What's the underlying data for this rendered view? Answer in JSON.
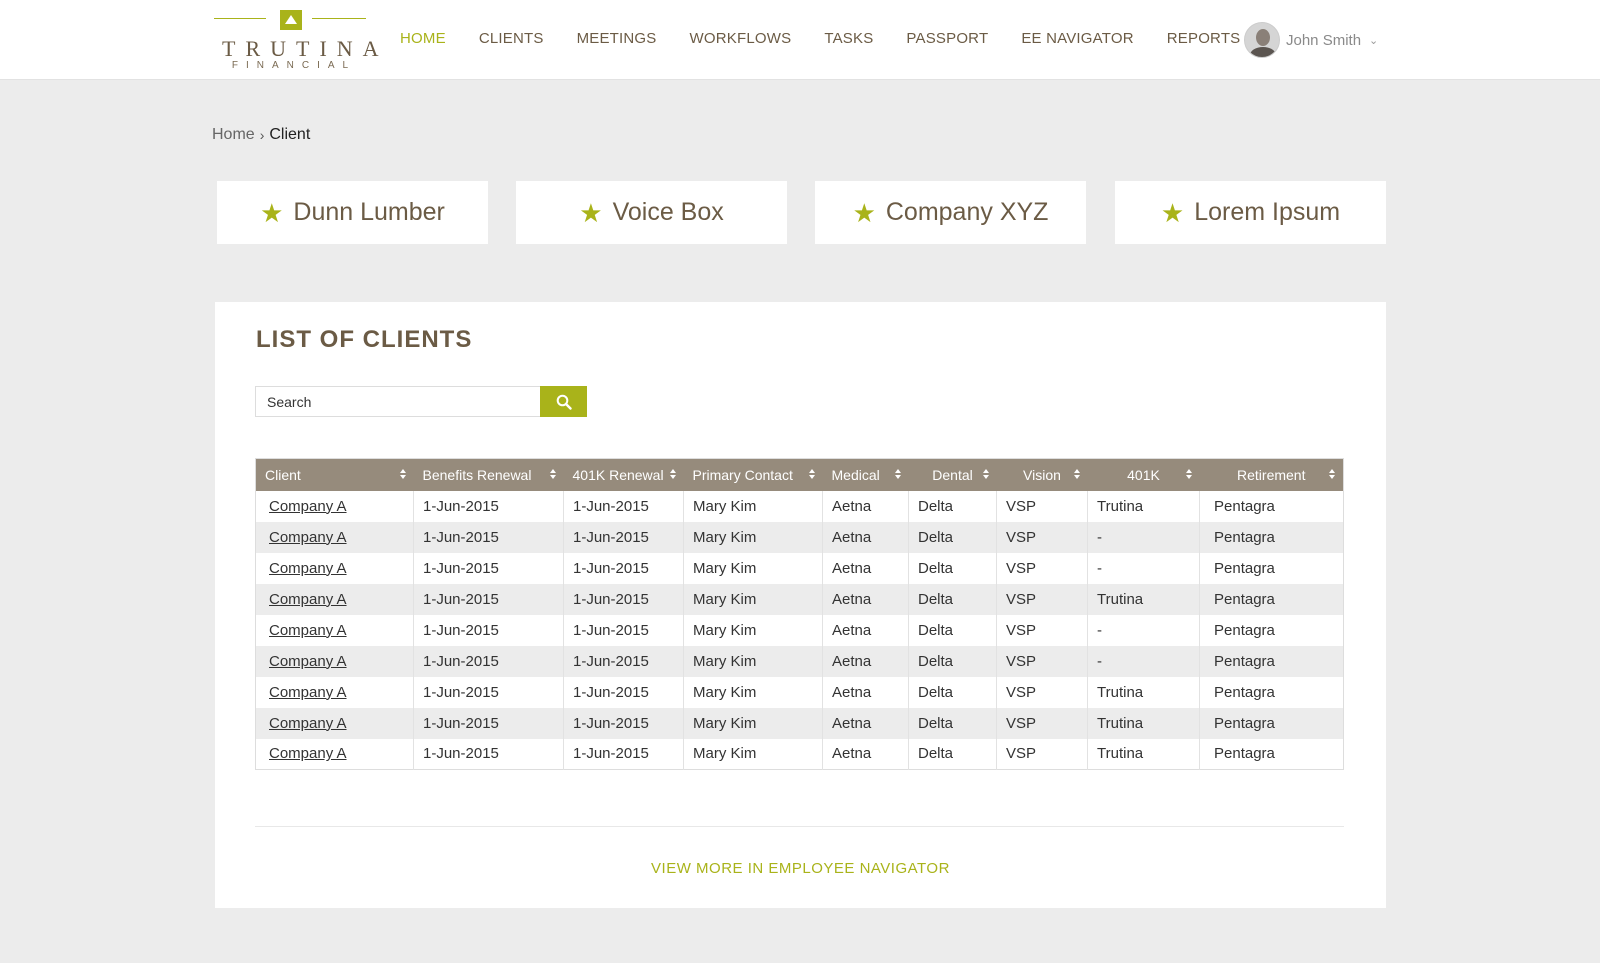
{
  "logo": {
    "word": "TRUTINA",
    "sub": "FINANCIAL"
  },
  "nav": [
    {
      "label": "HOME",
      "active": true
    },
    {
      "label": "CLIENTS"
    },
    {
      "label": "MEETINGS"
    },
    {
      "label": "WORKFLOWS"
    },
    {
      "label": "TASKS"
    },
    {
      "label": "PASSPORT"
    },
    {
      "label": "EE NAVIGATOR"
    },
    {
      "label": "REPORTS"
    }
  ],
  "user": {
    "name": "John Smith"
  },
  "breadcrumb": {
    "home": "Home",
    "separator": "›",
    "current": "Client"
  },
  "favorites": [
    {
      "label": "Dunn Lumber"
    },
    {
      "label": "Voice Box"
    },
    {
      "label": "Company XYZ"
    },
    {
      "label": "Lorem Ipsum"
    }
  ],
  "panel": {
    "title": "LIST OF CLIENTS",
    "search_placeholder": "Search",
    "view_more": "VIEW MORE IN EMPLOYEE NAVIGATOR"
  },
  "table": {
    "headers": [
      "Client",
      "Benefits Renewal",
      "401K Renewal",
      "Primary Contact",
      "Medical",
      "Dental",
      "Vision",
      "401K",
      "Retirement"
    ],
    "rows": [
      [
        "Company A",
        "1-Jun-2015",
        "1-Jun-2015",
        "Mary Kim",
        "Aetna",
        "Delta",
        "VSP",
        "Trutina",
        "Pentagra"
      ],
      [
        "Company A",
        "1-Jun-2015",
        "1-Jun-2015",
        "Mary Kim",
        "Aetna",
        "Delta",
        "VSP",
        "-",
        "Pentagra"
      ],
      [
        "Company A",
        "1-Jun-2015",
        "1-Jun-2015",
        "Mary Kim",
        "Aetna",
        "Delta",
        "VSP",
        "-",
        "Pentagra"
      ],
      [
        "Company A",
        "1-Jun-2015",
        "1-Jun-2015",
        "Mary Kim",
        "Aetna",
        "Delta",
        "VSP",
        "Trutina",
        "Pentagra"
      ],
      [
        "Company A",
        "1-Jun-2015",
        "1-Jun-2015",
        "Mary Kim",
        "Aetna",
        "Delta",
        "VSP",
        "-",
        "Pentagra"
      ],
      [
        "Company A",
        "1-Jun-2015",
        "1-Jun-2015",
        "Mary Kim",
        "Aetna",
        "Delta",
        "VSP",
        "-",
        "Pentagra"
      ],
      [
        "Company A",
        "1-Jun-2015",
        "1-Jun-2015",
        "Mary Kim",
        "Aetna",
        "Delta",
        "VSP",
        "Trutina",
        "Pentagra"
      ],
      [
        "Company A",
        "1-Jun-2015",
        "1-Jun-2015",
        "Mary Kim",
        "Aetna",
        "Delta",
        "VSP",
        "Trutina",
        "Pentagra"
      ],
      [
        "Company A",
        "1-Jun-2015",
        "1-Jun-2015",
        "Mary Kim",
        "Aetna",
        "Delta",
        "VSP",
        "Trutina",
        "Pentagra"
      ]
    ]
  },
  "colors": {
    "accent": "#a9b31a",
    "brown": "#6b5b45",
    "table_header": "#968b7c",
    "background": "#ececec"
  },
  "icons": {
    "favorite": "star-icon",
    "search": "search-icon",
    "user_menu": "chevron-down-icon"
  }
}
